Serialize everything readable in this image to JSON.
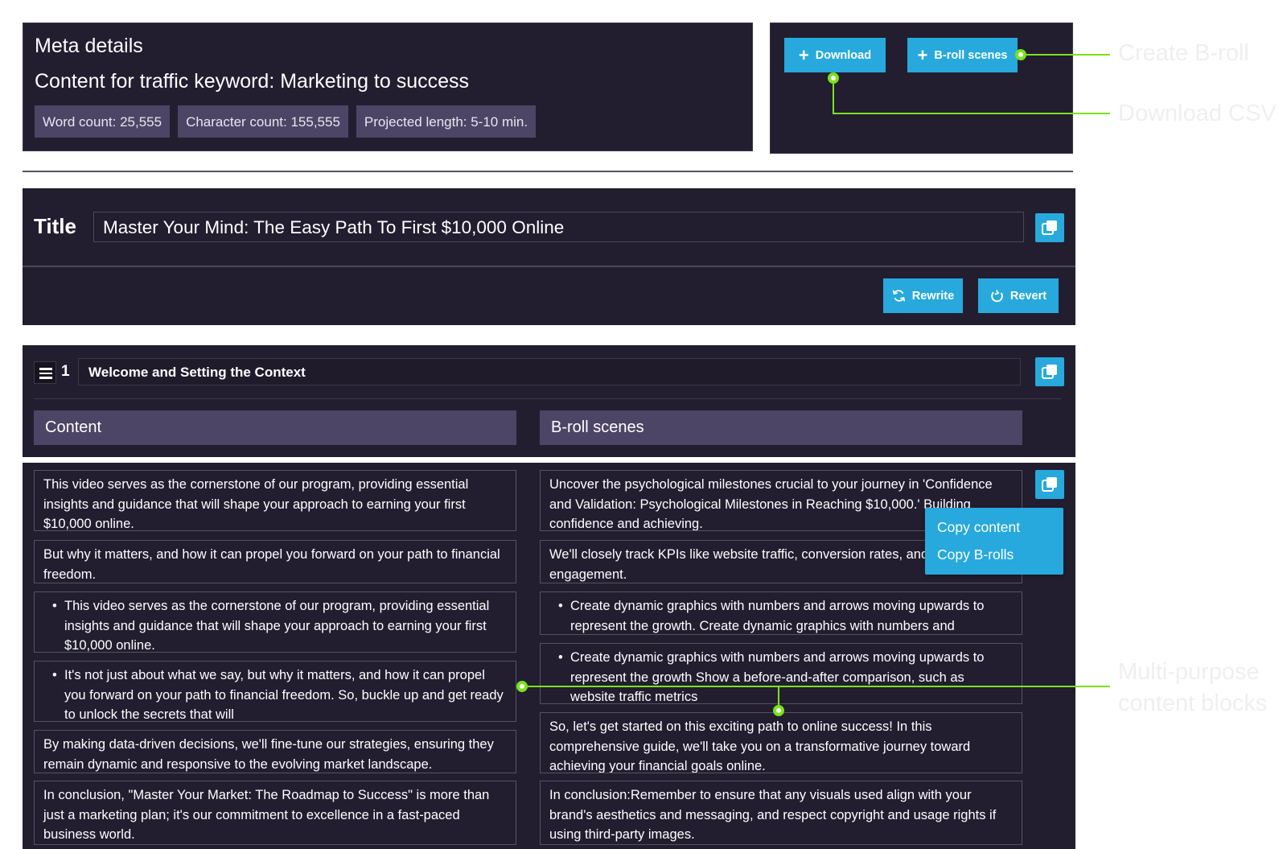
{
  "meta": {
    "heading": "Meta details",
    "keyword_line": "Content for traffic keyword: Marketing to success",
    "badges": [
      "Word count: 25,555",
      "Character count: 155,555",
      "Projected length: 5-10 min."
    ]
  },
  "actions": {
    "download_label": "Download",
    "broll_label": "B-roll scenes"
  },
  "title_block": {
    "label": "Title",
    "value": "Master Your Mind: The Easy Path To First $10,000 Online",
    "rewrite_label": "Rewrite",
    "revert_label": "Revert"
  },
  "section": {
    "number": "1",
    "heading": "Welcome and Setting the Context",
    "content_header": "Content",
    "broll_header": "B-roll scenes"
  },
  "rows": {
    "content": [
      "This video serves as the cornerstone of our program, providing essential insights and guidance that will shape your approach to earning your first $10,000 online.",
      "But why it matters, and how it can propel you forward on your path to financial freedom.",
      "This video serves as the cornerstone of our program, providing essential insights and guidance that will shape your approach to earning your first $10,000 online.",
      "It's not just about what we say, but why it matters, and how it can propel you forward on your path to financial freedom. So, buckle up and get ready to unlock the secrets that will",
      "By making data-driven decisions, we'll fine-tune our strategies, ensuring they remain dynamic and responsive to the evolving market landscape.",
      "In conclusion, \"Master Your Market: The Roadmap to Success\" is more than just a marketing plan; it's our commitment to excellence in a fast-paced business world."
    ],
    "broll": [
      "Uncover the psychological milestones crucial to your journey in 'Confidence and Validation: Psychological Milestones in Reaching $10,000.' Building confidence and achieving.",
      "We'll closely track KPIs like website traffic, conversion rates, and social media engagement.",
      "Create dynamic graphics with numbers and arrows moving upwards to represent the growth. Create dynamic graphics with numbers and",
      "Create dynamic graphics with numbers and arrows moving upwards to represent the growth Show a before-and-after comparison, such as website traffic metrics",
      "So, let's get started on this exciting path to online success! In this comprehensive guide, we'll take you on a transformative journey toward achieving your financial goals online.",
      "In conclusion:Remember to ensure that any visuals used align with your brand's aesthetics and messaging, and respect copyright and usage rights if using third-party images."
    ]
  },
  "copy_menu": {
    "items": [
      "Copy content",
      "Copy B-rolls"
    ]
  },
  "callouts": {
    "create_broll": "Create B-roll",
    "download_csv": "Download CSV",
    "multi_purpose_line1": "Multi-purpose",
    "multi_purpose_line2": "content blocks"
  },
  "colors": {
    "panel_bg": "#221e30",
    "accent_blue": "#27a9dd",
    "header_purple": "#4d4565",
    "callout_green": "#7ae21c"
  },
  "icons": [
    "plus-icon",
    "copy-icon",
    "refresh-icon",
    "revert-icon",
    "drag-handle-icon"
  ]
}
